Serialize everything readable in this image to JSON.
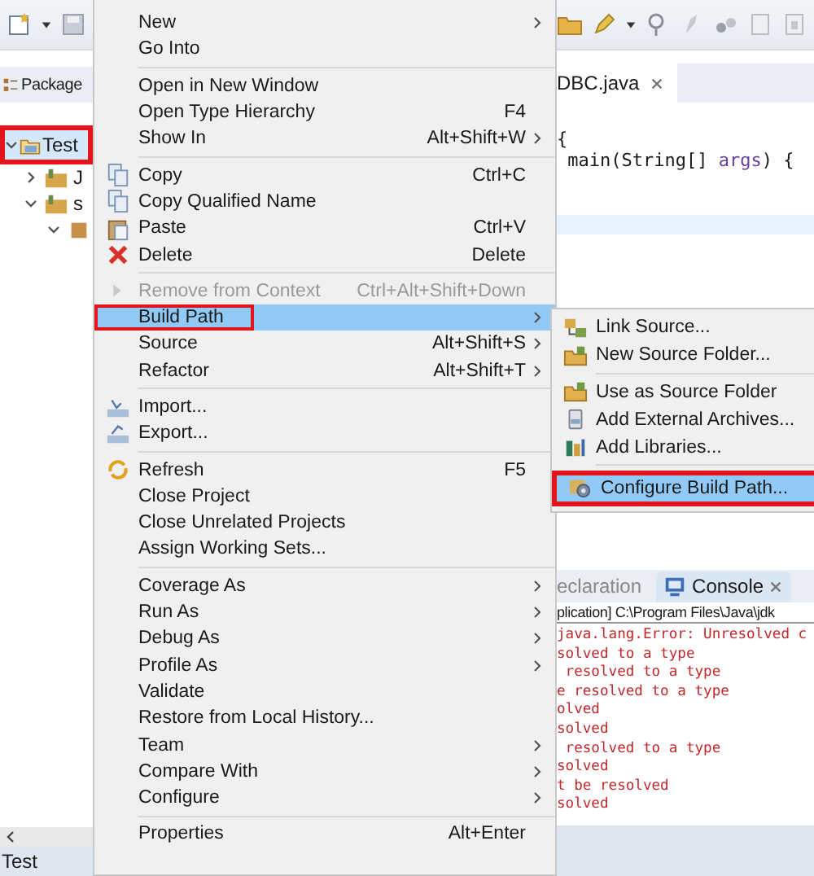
{
  "package_explorer": {
    "tab_label": "Package",
    "tree": [
      {
        "label": "Test",
        "selected": true,
        "highlighted": true,
        "expanded": true,
        "children": [
          {
            "label": "J",
            "selected": false,
            "highlighted": false,
            "expanded": false
          },
          {
            "label": "s",
            "selected": false,
            "highlighted": false,
            "expanded": true,
            "children": [
              {
                "selected": false,
                "highlighted": false,
                "expanded": true
              }
            ]
          }
        ]
      }
    ]
  },
  "editor": {
    "tab": {
      "label": "DBC.java"
    },
    "code_lines": [
      [
        {
          "text": "{",
          "kind": "plain"
        }
      ],
      [
        {
          "text": " main(String[] ",
          "kind": "plain"
        },
        {
          "text": "args",
          "kind": "param"
        },
        {
          "text": ") {",
          "kind": "plain"
        }
      ]
    ]
  },
  "console": {
    "tabs": [
      {
        "label": "eclaration",
        "selected": false
      },
      {
        "label": "Console",
        "selected": true
      }
    ],
    "header": "plication] C:\\Program Files\\Java\\jdk",
    "lines": [
      "java.lang.Error: Unresolved c",
      "solved to a type",
      " resolved to a type",
      "e resolved to a type",
      "olved",
      "solved",
      " resolved to a type",
      "solved",
      "t be resolved",
      "solved"
    ]
  },
  "status_bar": {
    "text": "Test"
  },
  "context_menu": {
    "groups": [
      [
        {
          "label": "New",
          "submenu": true,
          "disabled": false,
          "selected": false,
          "highlighted": false
        },
        {
          "label": "Go Into",
          "submenu": false,
          "disabled": false,
          "selected": false,
          "highlighted": false
        }
      ],
      [
        {
          "label": "Open in New Window",
          "submenu": false,
          "disabled": false,
          "selected": false,
          "highlighted": false
        },
        {
          "label": "Open Type Hierarchy",
          "shortcut": "F4",
          "submenu": false,
          "disabled": false,
          "selected": false,
          "highlighted": false
        },
        {
          "label": "Show In",
          "shortcut": "Alt+Shift+W",
          "submenu": true,
          "disabled": false,
          "selected": false,
          "highlighted": false
        }
      ],
      [
        {
          "label": "Copy",
          "shortcut": "Ctrl+C",
          "submenu": false,
          "disabled": false,
          "selected": false,
          "highlighted": false
        },
        {
          "label": "Copy Qualified Name",
          "submenu": false,
          "disabled": false,
          "selected": false,
          "highlighted": false
        },
        {
          "label": "Paste",
          "shortcut": "Ctrl+V",
          "submenu": false,
          "disabled": false,
          "selected": false,
          "highlighted": false
        },
        {
          "label": "Delete",
          "shortcut": "Delete",
          "submenu": false,
          "disabled": false,
          "selected": false,
          "highlighted": false
        }
      ],
      [
        {
          "label": "Remove from Context",
          "shortcut": "Ctrl+Alt+Shift+Down",
          "submenu": false,
          "disabled": true,
          "selected": false,
          "highlighted": false
        },
        {
          "label": "Build Path",
          "submenu": true,
          "disabled": false,
          "selected": true,
          "highlighted": true
        },
        {
          "label": "Source",
          "shortcut": "Alt+Shift+S",
          "submenu": true,
          "disabled": false,
          "selected": false,
          "highlighted": false
        },
        {
          "label": "Refactor",
          "shortcut": "Alt+Shift+T",
          "submenu": true,
          "disabled": false,
          "selected": false,
          "highlighted": false
        }
      ],
      [
        {
          "label": "Import...",
          "submenu": false,
          "disabled": false,
          "selected": false,
          "highlighted": false
        },
        {
          "label": "Export...",
          "submenu": false,
          "disabled": false,
          "selected": false,
          "highlighted": false
        }
      ],
      [
        {
          "label": "Refresh",
          "shortcut": "F5",
          "submenu": false,
          "disabled": false,
          "selected": false,
          "highlighted": false
        },
        {
          "label": "Close Project",
          "submenu": false,
          "disabled": false,
          "selected": false,
          "highlighted": false
        },
        {
          "label": "Close Unrelated Projects",
          "submenu": false,
          "disabled": false,
          "selected": false,
          "highlighted": false
        },
        {
          "label": "Assign Working Sets...",
          "submenu": false,
          "disabled": false,
          "selected": false,
          "highlighted": false
        }
      ],
      [
        {
          "label": "Coverage As",
          "submenu": true,
          "disabled": false,
          "selected": false,
          "highlighted": false
        },
        {
          "label": "Run As",
          "submenu": true,
          "disabled": false,
          "selected": false,
          "highlighted": false
        },
        {
          "label": "Debug As",
          "submenu": true,
          "disabled": false,
          "selected": false,
          "highlighted": false
        },
        {
          "label": "Profile As",
          "submenu": true,
          "disabled": false,
          "selected": false,
          "highlighted": false
        },
        {
          "label": "Validate",
          "submenu": false,
          "disabled": false,
          "selected": false,
          "highlighted": false
        },
        {
          "label": "Restore from Local History...",
          "submenu": false,
          "disabled": false,
          "selected": false,
          "highlighted": false
        },
        {
          "label": "Team",
          "submenu": true,
          "disabled": false,
          "selected": false,
          "highlighted": false
        },
        {
          "label": "Compare With",
          "submenu": true,
          "disabled": false,
          "selected": false,
          "highlighted": false
        },
        {
          "label": "Configure",
          "submenu": true,
          "disabled": false,
          "selected": false,
          "highlighted": false
        }
      ],
      [
        {
          "label": "Properties",
          "shortcut": "Alt+Enter",
          "submenu": false,
          "disabled": false,
          "selected": false,
          "highlighted": false
        }
      ]
    ]
  },
  "build_path_submenu": {
    "groups": [
      [
        {
          "label": "Link Source...",
          "selected": false,
          "highlighted": false
        },
        {
          "label": "New Source Folder...",
          "selected": false,
          "highlighted": false
        }
      ],
      [
        {
          "label": "Use as Source Folder",
          "selected": false,
          "highlighted": false
        },
        {
          "label": "Add External Archives...",
          "selected": false,
          "highlighted": false
        },
        {
          "label": "Add Libraries...",
          "selected": false,
          "highlighted": false
        }
      ],
      [
        {
          "label": "Configure Build Path...",
          "selected": true,
          "highlighted": true
        }
      ]
    ]
  }
}
